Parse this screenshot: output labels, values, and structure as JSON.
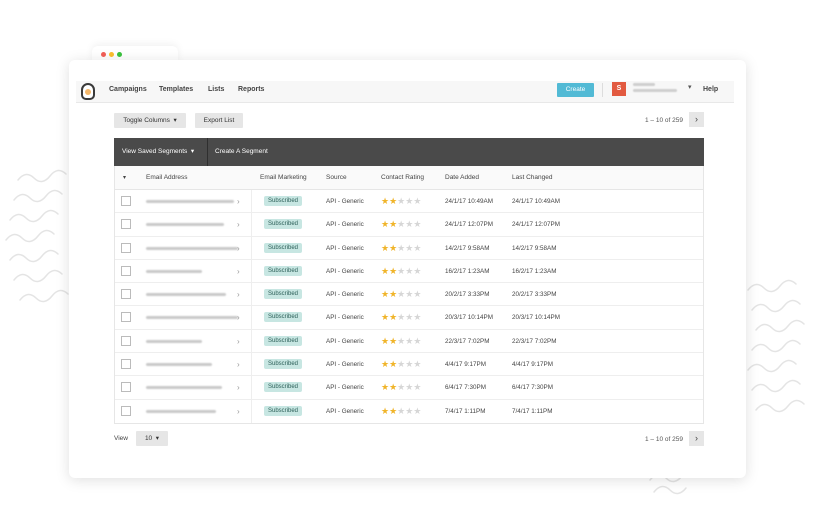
{
  "nav": {
    "links": [
      "Campaigns",
      "Templates",
      "Lists",
      "Reports"
    ],
    "create_label": "Create",
    "avatar_letter": "S",
    "help_label": "Help"
  },
  "toolbar": {
    "toggle_columns_label": "Toggle Columns",
    "export_list_label": "Export List",
    "pager_top": "1 – 10 of 259"
  },
  "segments": {
    "view_saved_label": "View Saved Segments",
    "create_label": "Create A Segment"
  },
  "table": {
    "headers": [
      "Email Address",
      "Email Marketing",
      "Source",
      "Contact Rating",
      "Date Added",
      "Last Changed"
    ],
    "rows": [
      {
        "status": "Subscribed",
        "source": "API - Generic",
        "rating": 2,
        "added": "24/1/17 10:49AM",
        "changed": "24/1/17 10:49AM"
      },
      {
        "status": "Subscribed",
        "source": "API - Generic",
        "rating": 2,
        "added": "24/1/17 12:07PM",
        "changed": "24/1/17 12:07PM"
      },
      {
        "status": "Subscribed",
        "source": "API - Generic",
        "rating": 2,
        "added": "14/2/17 9:58AM",
        "changed": "14/2/17 9:58AM"
      },
      {
        "status": "Subscribed",
        "source": "API - Generic",
        "rating": 2,
        "added": "16/2/17 1:23AM",
        "changed": "16/2/17 1:23AM"
      },
      {
        "status": "Subscribed",
        "source": "API - Generic",
        "rating": 2,
        "added": "20/2/17 3:33PM",
        "changed": "20/2/17 3:33PM"
      },
      {
        "status": "Subscribed",
        "source": "API - Generic",
        "rating": 2,
        "added": "20/3/17 10:14PM",
        "changed": "20/3/17 10:14PM"
      },
      {
        "status": "Subscribed",
        "source": "API - Generic",
        "rating": 2,
        "added": "22/3/17 7:02PM",
        "changed": "22/3/17 7:02PM"
      },
      {
        "status": "Subscribed",
        "source": "API - Generic",
        "rating": 2,
        "added": "4/4/17 9:17PM",
        "changed": "4/4/17 9:17PM"
      },
      {
        "status": "Subscribed",
        "source": "API - Generic",
        "rating": 2,
        "added": "6/4/17 7:30PM",
        "changed": "6/4/17 7:30PM"
      },
      {
        "status": "Subscribed",
        "source": "API - Generic",
        "rating": 2,
        "added": "7/4/17 1:11PM",
        "changed": "7/4/17 1:11PM"
      }
    ]
  },
  "footer": {
    "view_label": "View",
    "per_page_value": "10",
    "pager_bottom": "1 – 10 of 259"
  },
  "colors": {
    "accent": "#52bad5",
    "avatar": "#e25a40",
    "badge_bg": "#c7e6e2",
    "star": "#f0b429",
    "segment_bar": "#4a4a4a"
  }
}
